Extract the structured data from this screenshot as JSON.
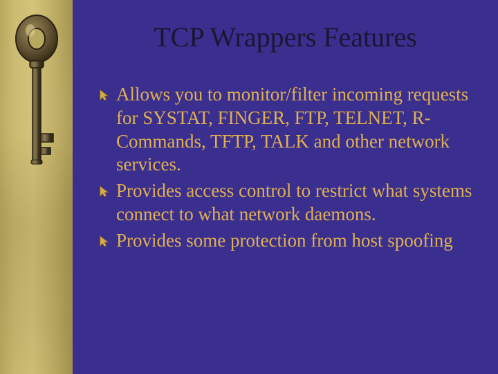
{
  "title": "TCP Wrappers Features",
  "bullets": [
    {
      "text": "Allows you to monitor/filter incoming requests for SYSTAT, FINGER, FTP, TELNET, R-Commands, TFTP, TALK and other network services."
    },
    {
      "text": "Provides access control to restrict what systems connect to what network daemons."
    },
    {
      "text": "Provides some protection from host spoofing"
    }
  ],
  "colors": {
    "background": "#3a2f8f",
    "title": "#1a1633",
    "bullet_text": "#e0b050",
    "pointer_icon": "#d8a948",
    "strip_base": "#cbbc72"
  }
}
